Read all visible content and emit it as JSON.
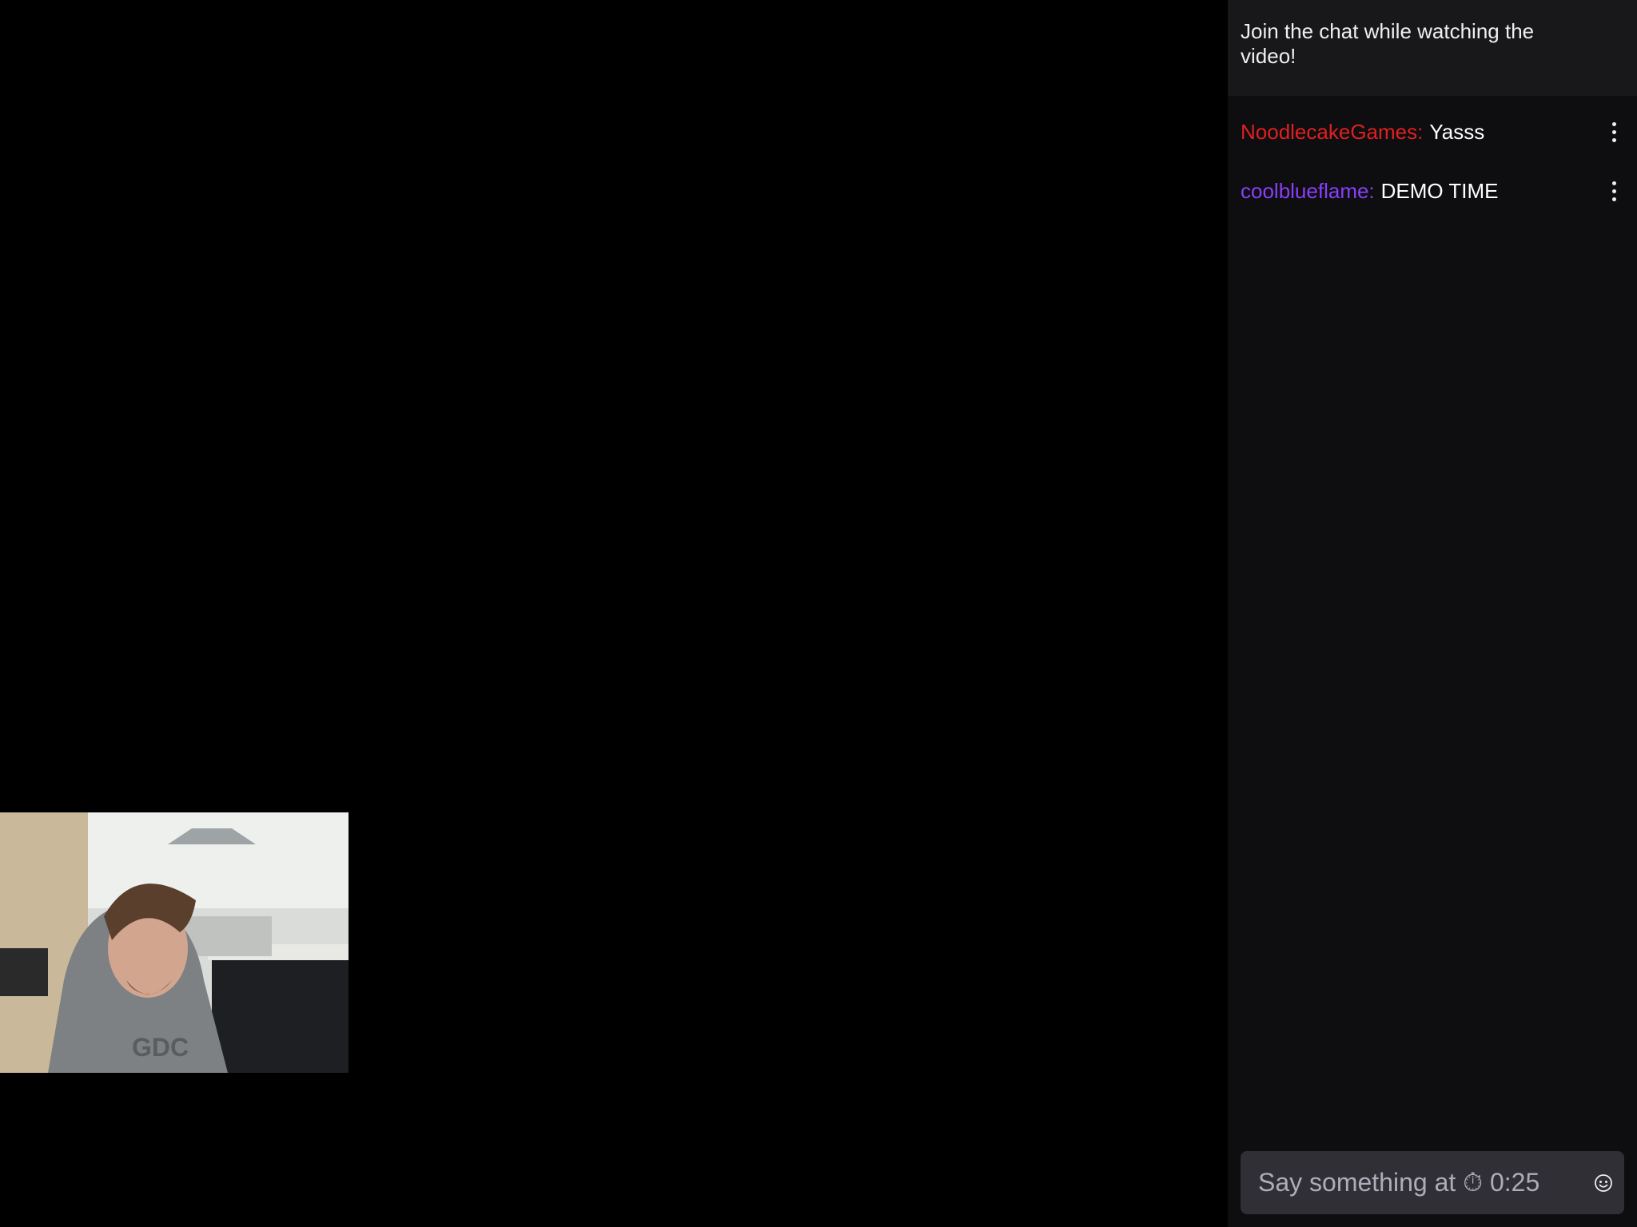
{
  "chat": {
    "header": "Join the chat while watching the video!",
    "messages": [
      {
        "username": "NoodlecakeGames:",
        "text": "Yasss",
        "username_color": "#e02020"
      },
      {
        "username": "coolblueflame:",
        "text": "DEMO TIME",
        "username_color": "#8a3ffc"
      }
    ],
    "input": {
      "placeholder": "Say something at ⏱ 0:25"
    },
    "icons": {
      "more": "more-vertical-icon",
      "emoji": "smiley-icon"
    }
  },
  "colors": {
    "panel_bg": "#0e0e10",
    "header_bg": "#18181b",
    "input_bg": "#2f2f35"
  }
}
